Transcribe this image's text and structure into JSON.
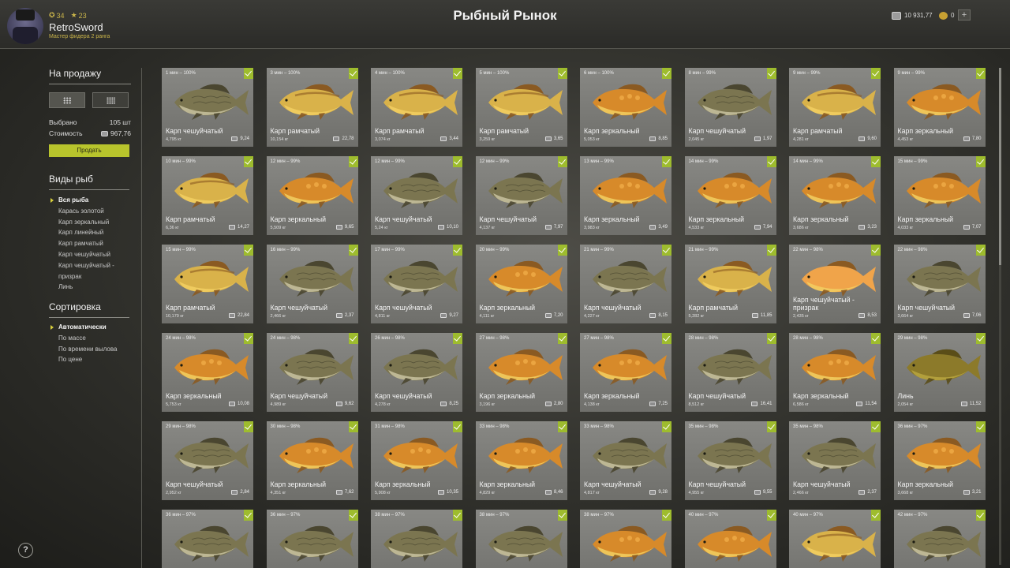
{
  "header": {
    "title": "Рыбный Рынок",
    "level": "34",
    "stars": "23",
    "username": "RetroSword",
    "rank": "Мастер фидера 2 ранга",
    "silver": "10 931,77",
    "gold": "0",
    "plus": "+"
  },
  "sidebar": {
    "sale_title": "На продажу",
    "selected_label": "Выбрано",
    "selected_value": "105 шт",
    "cost_label": "Стоимость",
    "cost_value": "967,76",
    "sell_button": "Продать",
    "types_title": "Виды рыб",
    "types": [
      "Вся рыба",
      "Карась золотой",
      "Карп зеркальный",
      "Карп линейный",
      "Карп рамчатый",
      "Карп чешуйчатый",
      "Карп чешуйчатый - призрак",
      "Линь"
    ],
    "active_type": 0,
    "sort_title": "Сортировка",
    "sorts": [
      "Автоматически",
      "По массе",
      "По времени вылова",
      "По цене"
    ],
    "active_sort": 0
  },
  "help": "?",
  "fish": [
    {
      "time": "1 мин – 100%",
      "name": "Карп чешуйчатый",
      "weight": "4,795 кг",
      "price": "9,24",
      "kind": "scaled"
    },
    {
      "time": "3 мин – 100%",
      "name": "Карп рамчатый",
      "weight": "10,154 кг",
      "price": "22,78",
      "kind": "frame"
    },
    {
      "time": "4 мин – 100%",
      "name": "Карп рамчатый",
      "weight": "3,074 кг",
      "price": "3,44",
      "kind": "frame"
    },
    {
      "time": "5 мин – 100%",
      "name": "Карп рамчатый",
      "weight": "3,259 кг",
      "price": "3,65",
      "kind": "frame"
    },
    {
      "time": "6 мин – 100%",
      "name": "Карп зеркальный",
      "weight": "5,053 кг",
      "price": "8,85",
      "kind": "mirror"
    },
    {
      "time": "8 мин – 99%",
      "name": "Карп чешуйчатый",
      "weight": "2,045 кг",
      "price": "1,97",
      "kind": "scaled"
    },
    {
      "time": "9 мин – 99%",
      "name": "Карп рамчатый",
      "weight": "4,281 кг",
      "price": "9,60",
      "kind": "frame"
    },
    {
      "time": "9 мин – 99%",
      "name": "Карп зеркальный",
      "weight": "4,453 кг",
      "price": "7,80",
      "kind": "mirror"
    },
    {
      "time": "10 мин – 99%",
      "name": "Карп рамчатый",
      "weight": "6,36 кг",
      "price": "14,27",
      "kind": "frame"
    },
    {
      "time": "12 мин – 99%",
      "name": "Карп зеркальный",
      "weight": "5,509 кг",
      "price": "9,65",
      "kind": "mirror"
    },
    {
      "time": "12 мин – 99%",
      "name": "Карп чешуйчатый",
      "weight": "5,24 кг",
      "price": "10,10",
      "kind": "scaled"
    },
    {
      "time": "12 мин – 99%",
      "name": "Карп чешуйчатый",
      "weight": "4,137 кг",
      "price": "7,97",
      "kind": "scaled"
    },
    {
      "time": "13 мин – 99%",
      "name": "Карп зеркальный",
      "weight": "3,983 кг",
      "price": "3,49",
      "kind": "mirror"
    },
    {
      "time": "14 мин – 99%",
      "name": "Карп зеркальный",
      "weight": "4,533 кг",
      "price": "7,94",
      "kind": "mirror"
    },
    {
      "time": "14 мин – 99%",
      "name": "Карп зеркальный",
      "weight": "3,686 кг",
      "price": "3,23",
      "kind": "mirror"
    },
    {
      "time": "15 мин – 99%",
      "name": "Карп зеркальный",
      "weight": "4,033 кг",
      "price": "7,07",
      "kind": "mirror"
    },
    {
      "time": "15 мин – 99%",
      "name": "Карп рамчатый",
      "weight": "10,179 кг",
      "price": "22,84",
      "kind": "frame"
    },
    {
      "time": "16 мин – 99%",
      "name": "Карп чешуйчатый",
      "weight": "2,466 кг",
      "price": "2,37",
      "kind": "scaled"
    },
    {
      "time": "17 мин – 99%",
      "name": "Карп чешуйчатый",
      "weight": "4,811 кг",
      "price": "9,27",
      "kind": "scaled"
    },
    {
      "time": "20 мин – 99%",
      "name": "Карп зеркальный",
      "weight": "4,111 кг",
      "price": "7,20",
      "kind": "mirror"
    },
    {
      "time": "21 мин – 99%",
      "name": "Карп чешуйчатый",
      "weight": "4,227 кг",
      "price": "8,15",
      "kind": "scaled"
    },
    {
      "time": "21 мин – 99%",
      "name": "Карп рамчатый",
      "weight": "5,282 кг",
      "price": "11,85",
      "kind": "frame"
    },
    {
      "time": "22 мин – 98%",
      "name": "Карп чешуйчатый - призрак",
      "weight": "2,435 кг",
      "price": "8,53",
      "kind": "ghost"
    },
    {
      "time": "22 мин – 98%",
      "name": "Карп чешуйчатый",
      "weight": "3,664 кг",
      "price": "7,06",
      "kind": "scaled"
    },
    {
      "time": "24 мин – 98%",
      "name": "Карп зеркальный",
      "weight": "5,753 кг",
      "price": "10,08",
      "kind": "mirror"
    },
    {
      "time": "24 мин – 98%",
      "name": "Карп чешуйчатый",
      "weight": "4,989 кг",
      "price": "9,62",
      "kind": "scaled"
    },
    {
      "time": "26 мин – 98%",
      "name": "Карп чешуйчатый",
      "weight": "4,278 кг",
      "price": "8,25",
      "kind": "scaled"
    },
    {
      "time": "27 мин – 98%",
      "name": "Карп зеркальный",
      "weight": "3,196 кг",
      "price": "2,80",
      "kind": "mirror"
    },
    {
      "time": "27 мин – 98%",
      "name": "Карп зеркальный",
      "weight": "4,138 кг",
      "price": "7,25",
      "kind": "mirror"
    },
    {
      "time": "28 мин – 98%",
      "name": "Карп чешуйчатый",
      "weight": "8,512 кг",
      "price": "16,41",
      "kind": "scaled"
    },
    {
      "time": "28 мин – 98%",
      "name": "Карп зеркальный",
      "weight": "6,586 кг",
      "price": "11,54",
      "kind": "mirror"
    },
    {
      "time": "29 мин – 98%",
      "name": "Линь",
      "weight": "2,054 кг",
      "price": "11,52",
      "kind": "tench"
    },
    {
      "time": "29 мин – 98%",
      "name": "Карп чешуйчатый",
      "weight": "2,952 кг",
      "price": "2,84",
      "kind": "scaled"
    },
    {
      "time": "30 мин – 98%",
      "name": "Карп зеркальный",
      "weight": "4,351 кг",
      "price": "7,62",
      "kind": "mirror"
    },
    {
      "time": "31 мин – 98%",
      "name": "Карп зеркальный",
      "weight": "5,908 кг",
      "price": "10,35",
      "kind": "mirror"
    },
    {
      "time": "33 мин – 98%",
      "name": "Карп зеркальный",
      "weight": "4,829 кг",
      "price": "8,46",
      "kind": "mirror"
    },
    {
      "time": "33 мин – 98%",
      "name": "Карп чешуйчатый",
      "weight": "4,817 кг",
      "price": "9,28",
      "kind": "scaled"
    },
    {
      "time": "35 мин – 98%",
      "name": "Карп чешуйчатый",
      "weight": "4,955 кг",
      "price": "9,55",
      "kind": "scaled"
    },
    {
      "time": "35 мин – 98%",
      "name": "Карп чешуйчатый",
      "weight": "2,466 кг",
      "price": "2,37",
      "kind": "scaled"
    },
    {
      "time": "36 мин – 97%",
      "name": "Карп зеркальный",
      "weight": "3,668 кг",
      "price": "3,21",
      "kind": "mirror"
    },
    {
      "time": "36 мин – 97%",
      "name": "",
      "weight": "",
      "price": "",
      "kind": "scaled"
    },
    {
      "time": "36 мин – 97%",
      "name": "",
      "weight": "",
      "price": "",
      "kind": "scaled"
    },
    {
      "time": "38 мин – 97%",
      "name": "",
      "weight": "",
      "price": "",
      "kind": "scaled"
    },
    {
      "time": "38 мин – 97%",
      "name": "",
      "weight": "",
      "price": "",
      "kind": "scaled"
    },
    {
      "time": "38 мин – 97%",
      "name": "",
      "weight": "",
      "price": "",
      "kind": "mirror"
    },
    {
      "time": "40 мин – 97%",
      "name": "",
      "weight": "",
      "price": "",
      "kind": "mirror"
    },
    {
      "time": "40 мин – 97%",
      "name": "",
      "weight": "",
      "price": "",
      "kind": "frame"
    },
    {
      "time": "42 мин – 97%",
      "name": "",
      "weight": "",
      "price": "",
      "kind": "scaled"
    }
  ],
  "colors": {
    "accent": "#b8c42c",
    "check": "#9ebc2e",
    "scaled_body": "#7b7550",
    "mirror_body": "#d78a2a",
    "frame_body": "#d9b24a",
    "ghost_body": "#f0a44a",
    "tench_body": "#8c7a2a"
  }
}
